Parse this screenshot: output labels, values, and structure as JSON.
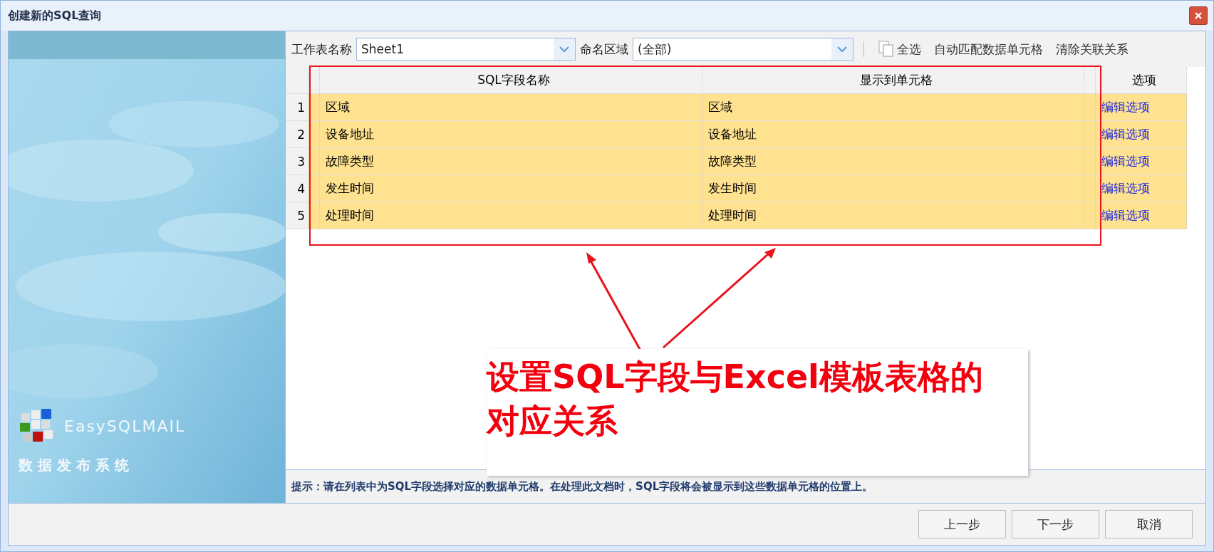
{
  "window": {
    "title": "创建新的SQL查询"
  },
  "banner": {
    "brand": "EasySQLMAIL",
    "subtitle": "数 据 发 布 系 统"
  },
  "toolbar": {
    "sheet_label": "工作表名称",
    "sheet_value": "Sheet1",
    "range_label": "命名区域",
    "range_value": "(全部)",
    "actions": [
      {
        "label": "全选",
        "kind": "icon"
      },
      {
        "label": "自动匹配数据单元格",
        "kind": "text"
      },
      {
        "label": "清除关联关系",
        "kind": "text"
      }
    ]
  },
  "table": {
    "columns": [
      "SQL字段名称",
      "显示到单元格",
      "选项"
    ],
    "rows": [
      {
        "index": "1",
        "field": "区域",
        "cell": "区域",
        "option": "编辑选项"
      },
      {
        "index": "2",
        "field": "设备地址",
        "cell": "设备地址",
        "option": "编辑选项"
      },
      {
        "index": "3",
        "field": "故障类型",
        "cell": "故障类型",
        "option": "编辑选项"
      },
      {
        "index": "4",
        "field": "发生时间",
        "cell": "发生时间",
        "option": "编辑选项"
      },
      {
        "index": "5",
        "field": "处理时间",
        "cell": "处理时间",
        "option": "编辑选项"
      }
    ]
  },
  "annotation": {
    "text": "设置SQL字段与Excel模板表格的对应关系"
  },
  "hint": "提示：请在列表中为SQL字段选择对应的数据单元格。在处理此文档时，SQL字段将会被显示到这些数据单元格的位置上。",
  "buttons": [
    "上一步",
    "下一步",
    "取消"
  ]
}
